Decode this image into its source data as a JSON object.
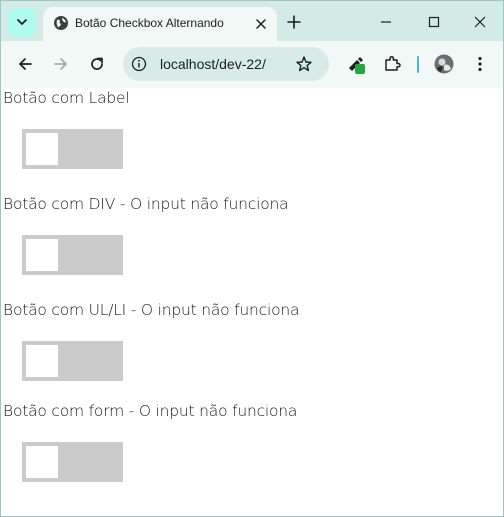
{
  "browser": {
    "tab_title": "Botão Checkbox Alternando",
    "url": "localhost/dev-22/"
  },
  "page": {
    "sections": [
      {
        "label": "Botão com Label",
        "checked": false
      },
      {
        "label": "Botão com DIV - O input não funciona",
        "checked": false
      },
      {
        "label": "Botão com UL/LI - O input não funciona",
        "checked": false
      },
      {
        "label": "Botão com form - O input não funciona",
        "checked": false
      }
    ]
  },
  "colors": {
    "titlebar": "#d3ebe6",
    "toolbar": "#f1f8f6",
    "switch_off": "#cbcbcb",
    "extension_badge": "#22a745"
  }
}
